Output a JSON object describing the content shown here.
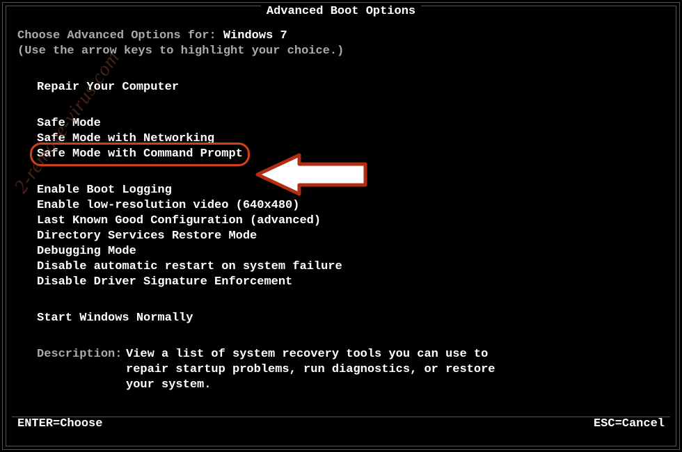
{
  "title": "Advanced Boot Options",
  "os_line_prefix": "Choose Advanced Options for: ",
  "os_name": "Windows 7",
  "hint": "(Use the arrow keys to highlight your choice.)",
  "repair": "Repair Your Computer",
  "options": {
    "safe_mode": "Safe Mode",
    "safe_mode_net": "Safe Mode with Networking",
    "safe_mode_cmd": "Safe Mode with Command Prompt",
    "boot_log": "Enable Boot Logging",
    "low_res": "Enable low-resolution video (640x480)",
    "lkgc": "Last Known Good Configuration (advanced)",
    "dsrm": "Directory Services Restore Mode",
    "debug": "Debugging Mode",
    "no_auto_restart": "Disable automatic restart on system failure",
    "no_drv_sig": "Disable Driver Signature Enforcement",
    "normal": "Start Windows Normally"
  },
  "desc_label": "Description:",
  "desc_text": "View a list of system recovery tools you can use to repair startup problems, run diagnostics, or restore your system.",
  "footer": {
    "enter": "ENTER=Choose",
    "esc": "ESC=Cancel"
  },
  "watermark": "2-remove-virus.com",
  "colors": {
    "highlight": "#d33f1a",
    "arrow_border": "#b22e13"
  }
}
